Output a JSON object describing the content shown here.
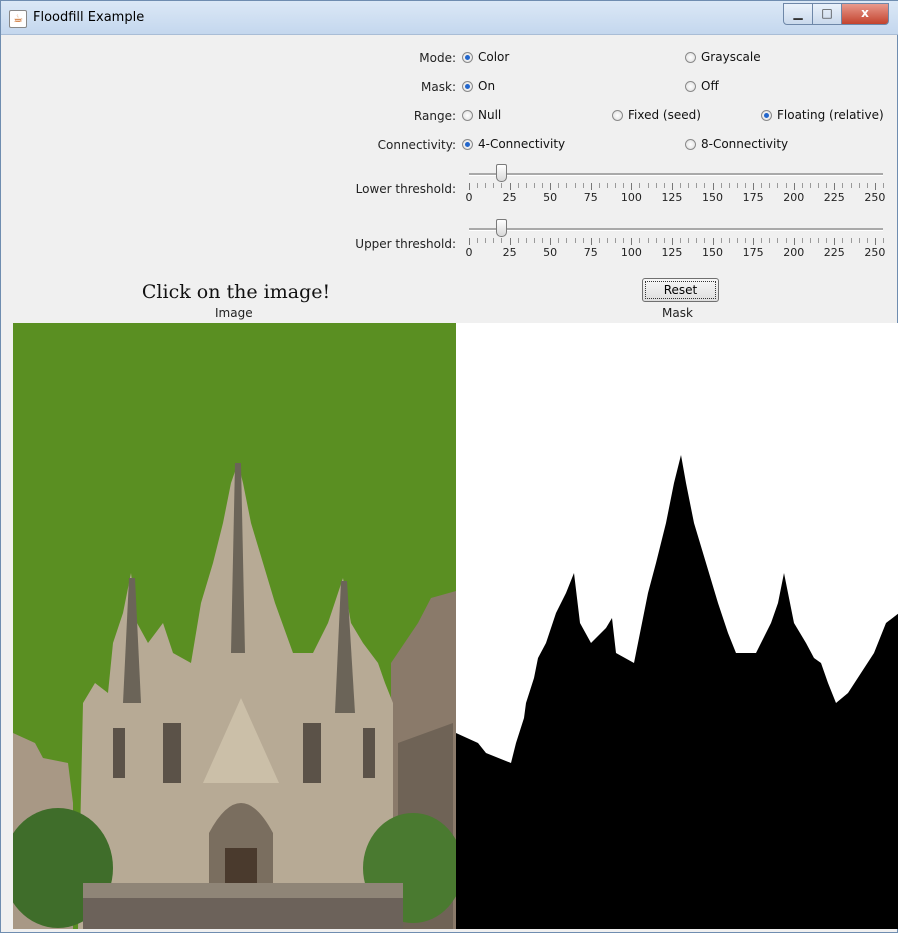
{
  "window": {
    "title": "Floodfill Example",
    "close_label": "x"
  },
  "mode": {
    "label": "Mode:",
    "options": [
      "Color",
      "Grayscale"
    ],
    "selected": "Color"
  },
  "mask": {
    "label": "Mask:",
    "options": [
      "On",
      "Off"
    ],
    "selected": "On"
  },
  "range": {
    "label": "Range:",
    "options": [
      "Null",
      "Fixed (seed)",
      "Floating (relative)"
    ],
    "selected": "Floating (relative)"
  },
  "connectivity": {
    "label": "Connectivity:",
    "options": [
      "4-Connectivity",
      "8-Connectivity"
    ],
    "selected": "4-Connectivity"
  },
  "lower_threshold": {
    "label": "Lower threshold:",
    "value": 20,
    "min": 0,
    "max": 255
  },
  "upper_threshold": {
    "label": "Upper threshold:",
    "value": 20,
    "min": 0,
    "max": 255
  },
  "slider_ticks": [
    "0",
    "25",
    "50",
    "75",
    "100",
    "125",
    "150",
    "175",
    "200",
    "225",
    "250"
  ],
  "reset_label": "Reset",
  "instruction": "Click on the image!",
  "image_caption": "Image",
  "mask_caption": "Mask",
  "colors": {
    "fill": "#5a8f22",
    "mask_fg": "#000000",
    "mask_bg": "#ffffff",
    "selected_radio": "#2266cc"
  }
}
